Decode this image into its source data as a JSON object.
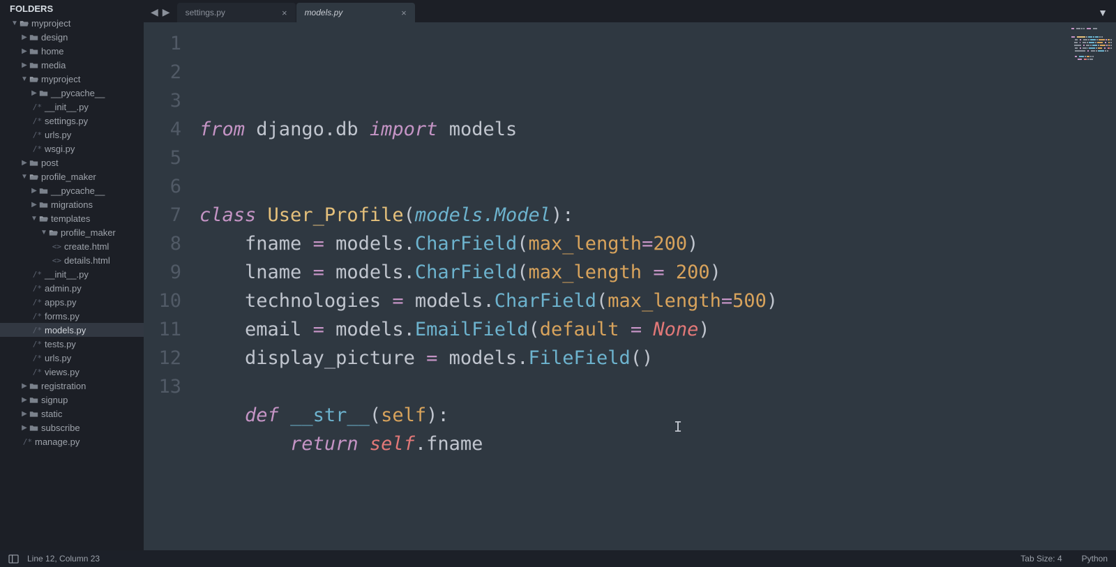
{
  "sidebar": {
    "title": "FOLDERS",
    "tree": [
      {
        "depth": 0,
        "type": "folder-open",
        "expand": "down",
        "label": "myproject"
      },
      {
        "depth": 1,
        "type": "folder",
        "expand": "right",
        "label": "design"
      },
      {
        "depth": 1,
        "type": "folder",
        "expand": "right",
        "label": "home"
      },
      {
        "depth": 1,
        "type": "folder",
        "expand": "right",
        "label": "media"
      },
      {
        "depth": 1,
        "type": "folder-open",
        "expand": "down",
        "label": "myproject"
      },
      {
        "depth": 2,
        "type": "folder",
        "expand": "right",
        "label": "__pycache__"
      },
      {
        "depth": 2,
        "type": "file",
        "tag": "/*",
        "label": "__init__.py"
      },
      {
        "depth": 2,
        "type": "file",
        "tag": "/*",
        "label": "settings.py"
      },
      {
        "depth": 2,
        "type": "file",
        "tag": "/*",
        "label": "urls.py"
      },
      {
        "depth": 2,
        "type": "file",
        "tag": "/*",
        "label": "wsgi.py"
      },
      {
        "depth": 1,
        "type": "folder",
        "expand": "right",
        "label": "post"
      },
      {
        "depth": 1,
        "type": "folder-open",
        "expand": "down",
        "label": "profile_maker"
      },
      {
        "depth": 2,
        "type": "folder",
        "expand": "right",
        "label": "__pycache__"
      },
      {
        "depth": 2,
        "type": "folder",
        "expand": "right",
        "label": "migrations"
      },
      {
        "depth": 2,
        "type": "folder-open",
        "expand": "down",
        "label": "templates"
      },
      {
        "depth": 3,
        "type": "folder-open",
        "expand": "down",
        "label": "profile_maker"
      },
      {
        "depth": 4,
        "type": "file",
        "tag": "<>",
        "label": "create.html"
      },
      {
        "depth": 4,
        "type": "file",
        "tag": "<>",
        "label": "details.html"
      },
      {
        "depth": 2,
        "type": "file",
        "tag": "/*",
        "label": "__init__.py"
      },
      {
        "depth": 2,
        "type": "file",
        "tag": "/*",
        "label": "admin.py"
      },
      {
        "depth": 2,
        "type": "file",
        "tag": "/*",
        "label": "apps.py"
      },
      {
        "depth": 2,
        "type": "file",
        "tag": "/*",
        "label": "forms.py"
      },
      {
        "depth": 2,
        "type": "file",
        "tag": "/*",
        "label": "models.py",
        "selected": true
      },
      {
        "depth": 2,
        "type": "file",
        "tag": "/*",
        "label": "tests.py"
      },
      {
        "depth": 2,
        "type": "file",
        "tag": "/*",
        "label": "urls.py"
      },
      {
        "depth": 2,
        "type": "file",
        "tag": "/*",
        "label": "views.py"
      },
      {
        "depth": 1,
        "type": "folder",
        "expand": "right",
        "label": "registration"
      },
      {
        "depth": 1,
        "type": "folder",
        "expand": "right",
        "label": "signup"
      },
      {
        "depth": 1,
        "type": "folder",
        "expand": "right",
        "label": "static"
      },
      {
        "depth": 1,
        "type": "folder",
        "expand": "right",
        "label": "subscribe"
      },
      {
        "depth": 1,
        "type": "file",
        "tag": "/*",
        "label": "manage.py"
      }
    ]
  },
  "tabs": [
    {
      "label": "settings.py",
      "active": false
    },
    {
      "label": "models.py",
      "active": true
    }
  ],
  "code_lines": [
    [
      {
        "t": "from",
        "c": "kw"
      },
      {
        "t": " "
      },
      {
        "t": "django",
        "c": "id"
      },
      {
        "t": ".",
        "c": "punc"
      },
      {
        "t": "db",
        "c": "id"
      },
      {
        "t": " "
      },
      {
        "t": "import",
        "c": "kw"
      },
      {
        "t": " "
      },
      {
        "t": "models",
        "c": "id"
      }
    ],
    [],
    [],
    [
      {
        "t": "class",
        "c": "kw"
      },
      {
        "t": " "
      },
      {
        "t": "User_Profile",
        "c": "cls"
      },
      {
        "t": "(",
        "c": "punc"
      },
      {
        "t": "models",
        "c": "type"
      },
      {
        "t": ".",
        "c": "type"
      },
      {
        "t": "Model",
        "c": "type"
      },
      {
        "t": ")",
        "c": "punc"
      },
      {
        "t": ":",
        "c": "punc"
      }
    ],
    [
      {
        "t": "    "
      },
      {
        "t": "fname",
        "c": "id"
      },
      {
        "t": " "
      },
      {
        "t": "=",
        "c": "op"
      },
      {
        "t": " "
      },
      {
        "t": "models",
        "c": "id"
      },
      {
        "t": ".",
        "c": "punc"
      },
      {
        "t": "CharField",
        "c": "func"
      },
      {
        "t": "(",
        "c": "punc"
      },
      {
        "t": "max_length",
        "c": "argn"
      },
      {
        "t": "=",
        "c": "op"
      },
      {
        "t": "200",
        "c": "num"
      },
      {
        "t": ")",
        "c": "punc"
      }
    ],
    [
      {
        "t": "    "
      },
      {
        "t": "lname",
        "c": "id"
      },
      {
        "t": " "
      },
      {
        "t": "=",
        "c": "op"
      },
      {
        "t": " "
      },
      {
        "t": "models",
        "c": "id"
      },
      {
        "t": ".",
        "c": "punc"
      },
      {
        "t": "CharField",
        "c": "func"
      },
      {
        "t": "(",
        "c": "punc"
      },
      {
        "t": "max_length",
        "c": "argn"
      },
      {
        "t": " "
      },
      {
        "t": "=",
        "c": "op"
      },
      {
        "t": " "
      },
      {
        "t": "200",
        "c": "num"
      },
      {
        "t": ")",
        "c": "punc"
      }
    ],
    [
      {
        "t": "    "
      },
      {
        "t": "technologies",
        "c": "id"
      },
      {
        "t": " "
      },
      {
        "t": "=",
        "c": "op"
      },
      {
        "t": " "
      },
      {
        "t": "models",
        "c": "id"
      },
      {
        "t": ".",
        "c": "punc"
      },
      {
        "t": "CharField",
        "c": "func"
      },
      {
        "t": "(",
        "c": "punc"
      },
      {
        "t": "max_length",
        "c": "argn"
      },
      {
        "t": "=",
        "c": "op"
      },
      {
        "t": "500",
        "c": "num"
      },
      {
        "t": ")",
        "c": "punc"
      }
    ],
    [
      {
        "t": "    "
      },
      {
        "t": "email",
        "c": "id"
      },
      {
        "t": " "
      },
      {
        "t": "=",
        "c": "op"
      },
      {
        "t": " "
      },
      {
        "t": "models",
        "c": "id"
      },
      {
        "t": ".",
        "c": "punc"
      },
      {
        "t": "EmailField",
        "c": "func"
      },
      {
        "t": "(",
        "c": "punc"
      },
      {
        "t": "default",
        "c": "argn"
      },
      {
        "t": " "
      },
      {
        "t": "=",
        "c": "op"
      },
      {
        "t": " "
      },
      {
        "t": "None",
        "c": "none"
      },
      {
        "t": ")",
        "c": "punc"
      }
    ],
    [
      {
        "t": "    "
      },
      {
        "t": "display_picture",
        "c": "id"
      },
      {
        "t": " "
      },
      {
        "t": "=",
        "c": "op"
      },
      {
        "t": " "
      },
      {
        "t": "models",
        "c": "id"
      },
      {
        "t": ".",
        "c": "punc"
      },
      {
        "t": "FileField",
        "c": "func"
      },
      {
        "t": "(",
        "c": "punc"
      },
      {
        "t": ")",
        "c": "punc"
      }
    ],
    [],
    [
      {
        "t": "    "
      },
      {
        "t": "def",
        "c": "kw"
      },
      {
        "t": " "
      },
      {
        "t": "__str__",
        "c": "builtin"
      },
      {
        "t": "(",
        "c": "punc"
      },
      {
        "t": "self",
        "c": "argn"
      },
      {
        "t": ")",
        "c": "punc"
      },
      {
        "t": ":",
        "c": "punc"
      }
    ],
    [
      {
        "t": "        "
      },
      {
        "t": "return",
        "c": "kw"
      },
      {
        "t": " "
      },
      {
        "t": "self",
        "c": "self"
      },
      {
        "t": ".",
        "c": "punc"
      },
      {
        "t": "fname",
        "c": "id"
      }
    ],
    []
  ],
  "highlight_line": 12,
  "status": {
    "position": "Line 12, Column 23",
    "tab_size": "Tab Size: 4",
    "language": "Python"
  }
}
